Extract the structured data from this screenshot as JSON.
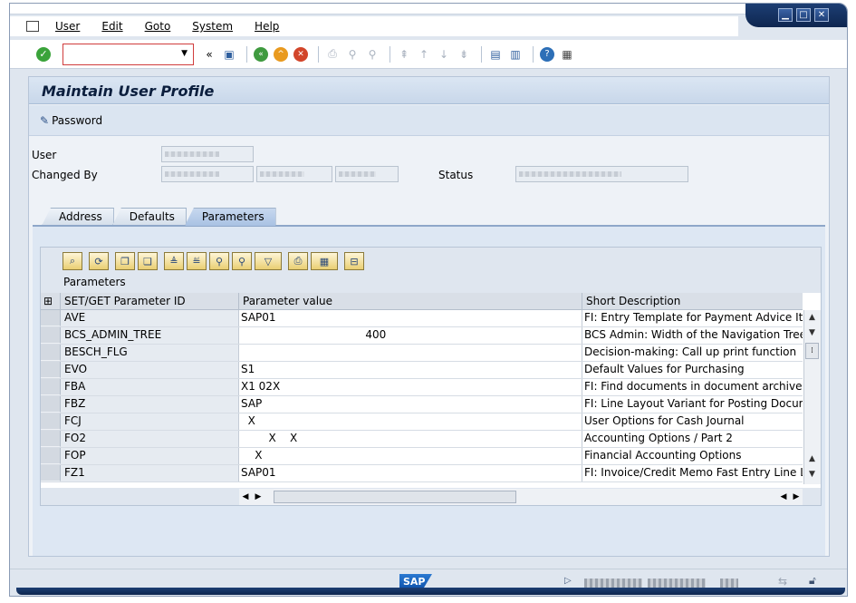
{
  "menu": {
    "items": [
      "User",
      "Edit",
      "Goto",
      "System",
      "Help"
    ]
  },
  "toolbar": {
    "command_value": "",
    "nav_back_glyph": "«"
  },
  "screen": {
    "title": "Maintain User Profile",
    "password_label": "Password"
  },
  "header_fields": {
    "user_label": "User",
    "changed_by_label": "Changed By",
    "status_label": "Status"
  },
  "tabs": [
    {
      "label": "Address",
      "active": false
    },
    {
      "label": "Defaults",
      "active": false
    },
    {
      "label": "Parameters",
      "active": true
    }
  ],
  "grid": {
    "title": "Parameters",
    "columns": [
      "SET/GET Parameter ID",
      "Parameter value",
      "Short Description"
    ],
    "rows": [
      {
        "id": "AVE",
        "value": "SAP01",
        "desc": "FI: Entry Template for Payment Advice Item"
      },
      {
        "id": "BCS_ADMIN_TREE",
        "value": "                                    400",
        "desc": "BCS Admin: Width of the Navigation Tree"
      },
      {
        "id": "BESCH_FLG",
        "value": "",
        "desc": "Decision-making: Call up print function"
      },
      {
        "id": "EVO",
        "value": "S1",
        "desc": "Default Values for Purchasing"
      },
      {
        "id": "FBA",
        "value": "X1 02X",
        "desc": "FI: Find documents in document archive if n"
      },
      {
        "id": "FBZ",
        "value": "SAP",
        "desc": "FI: Line Layout Variant for Posting Documen"
      },
      {
        "id": "FCJ",
        "value": "  X",
        "desc": "User Options for Cash Journal"
      },
      {
        "id": "FO2",
        "value": "        X    X",
        "desc": "Accounting Options / Part 2"
      },
      {
        "id": "FOP",
        "value": "    X",
        "desc": "Financial Accounting Options"
      },
      {
        "id": "FZ1",
        "value": "SAP01",
        "desc": "FI: Invoice/Credit Memo Fast Entry Line Layo"
      }
    ]
  },
  "colors": {
    "accent": "#0e2650",
    "background": "#dfe6ef"
  }
}
